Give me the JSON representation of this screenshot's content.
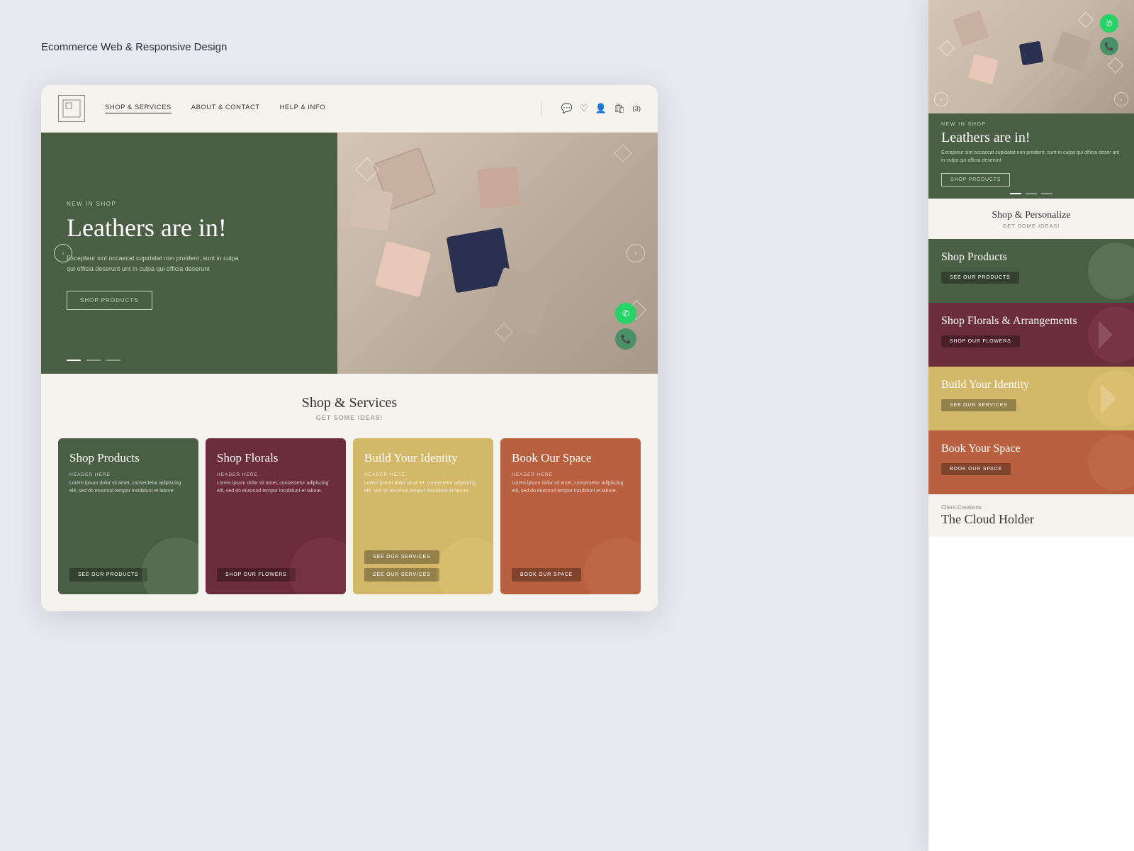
{
  "page": {
    "title": "Ecommerce Web & Responsive Design"
  },
  "nav": {
    "links": [
      {
        "label": "SHOP & SERVICES",
        "active": true
      },
      {
        "label": "ABOUT & CONTACT",
        "active": false
      },
      {
        "label": "HELP & INFO",
        "active": false
      }
    ],
    "cart_label": "(3)",
    "logo_text": ""
  },
  "hero": {
    "badge": "NEW IN SHOP",
    "title": "Leathers are in!",
    "text": "Excepteur sint occaecat cupidatat non proident, sunt in culpa qui officia deserunt unt in culpa qui officia deserunt",
    "btn_label": "SHOP PRODUCTS"
  },
  "services": {
    "title": "Shop & Services",
    "subtitle": "Get some ideas!",
    "cards": [
      {
        "title": "Shop Products",
        "header": "HEADER HERE",
        "text": "Lorem ipsum dolor sit amet, consectetur adipiscing elit, sed do eiusmod tempor incididunt et labore.",
        "btn": "SEE OUR PRODUCTS",
        "color": "green"
      },
      {
        "title": "Shop Florals",
        "header": "HEADER HERE",
        "text": "Lorem ipsum dolor sit amet, consectetur adipiscing elit, sed do eiusmod tempor incididunt et labore.",
        "btn": "SHOP OUR FLOWERS",
        "color": "maroon"
      },
      {
        "title": "Build Your Identity",
        "header": "HEADER HERE",
        "text": "Lorem ipsum dolor sit amet, consectetur adipiscing elit, sed do eiusmod tempor incididunt et labore.",
        "btn1": "SEE OUR SERVICES",
        "btn2": "SEE OUR SERVICES",
        "color": "yellow"
      },
      {
        "title": "Book Our Space",
        "header": "HEADER HERE",
        "text": "Lorem ipsum dolor sit amet, consectetur adipiscing elit, sed do eiusmod tempor incididunt et labore.",
        "btn": "BOOK OUR SPACE",
        "color": "orange"
      }
    ]
  },
  "mobile": {
    "hero": {
      "badge": "NEW IN SHOP",
      "title": "Leathers are in!",
      "text": "Excepteur sint occaecat cupidatat non proident, sunt in culpa qui officia deser unt in culpa qui officia deserunt",
      "btn_label": "SHOP PRODUCTS"
    },
    "personalize": {
      "title": "Shop & Personalize",
      "subtitle": "GET SOME IDEAS!"
    },
    "cards": [
      {
        "title": "Shop Products",
        "btn": "SEE OUR PRODUCTS",
        "color": "green"
      },
      {
        "title": "Shop Florals & Arrangements",
        "btn": "SHOP OUR FLOWERS",
        "color": "maroon"
      },
      {
        "title": "Build Your Identity",
        "btn": "SEE OUR SERVICES",
        "color": "yellow"
      },
      {
        "title": "Book Your Space",
        "btn": "BOOK OUR SPACE",
        "color": "orange"
      }
    ],
    "client": {
      "sub": "Client Creations",
      "title": "The Cloud Holder"
    }
  },
  "icons": {
    "chat": "💬",
    "heart": "♡",
    "user": "👤",
    "cart": "🛍",
    "left_arrow": "‹",
    "right_arrow": "›",
    "whatsapp": "✆",
    "phone": "📞"
  }
}
